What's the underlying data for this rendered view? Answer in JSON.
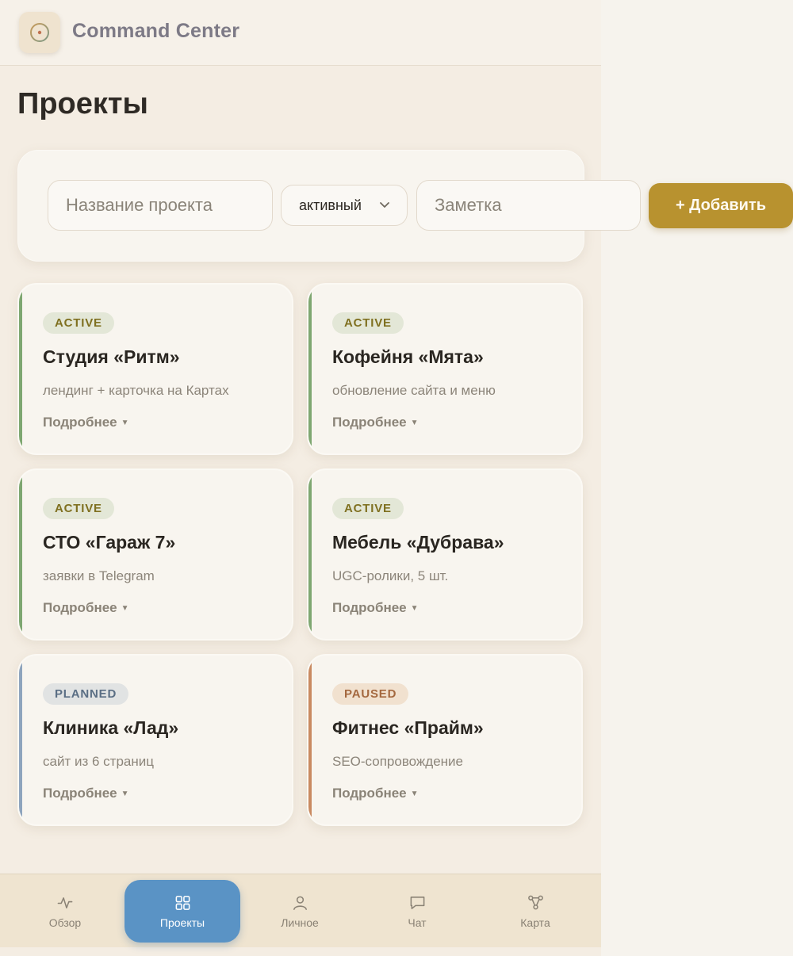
{
  "app": {
    "title": "Command Center",
    "logo_icon": "target-icon"
  },
  "page": {
    "title": "Проекты"
  },
  "form": {
    "name_placeholder": "Название проекта",
    "status_selected": "активный",
    "note_placeholder": "Заметка",
    "add_label": "+ Добавить"
  },
  "status_colors": {
    "active": {
      "stripe": "#7ea771",
      "badge_bg": "#e3e7d7",
      "badge_fg": "#7f7020"
    },
    "planned": {
      "stripe": "#8ea4bd",
      "badge_bg": "#e1e3e3",
      "badge_fg": "#5a6e84"
    },
    "paused": {
      "stripe": "#c98a61",
      "badge_bg": "#f1e1cf",
      "badge_fg": "#a4683f"
    }
  },
  "projects": [
    {
      "status": "active",
      "badge": "ACTIVE",
      "title": "Студия «Ритм»",
      "note": "лендинг + карточка на Картах",
      "more": "Подробнее"
    },
    {
      "status": "active",
      "badge": "ACTIVE",
      "title": "Кофейня «Мята»",
      "note": "обновление сайта и меню",
      "more": "Подробнее"
    },
    {
      "status": "active",
      "badge": "ACTIVE",
      "title": "СТО «Гараж 7»",
      "note": "заявки в Telegram",
      "more": "Подробнее"
    },
    {
      "status": "active",
      "badge": "ACTIVE",
      "title": "Мебель «Дубрава»",
      "note": "UGC-ролики, 5 шт.",
      "more": "Подробнее"
    },
    {
      "status": "planned",
      "badge": "PLANNED",
      "title": "Клиника «Лад»",
      "note": "сайт из 6 страниц",
      "more": "Подробнее"
    },
    {
      "status": "paused",
      "badge": "PAUSED",
      "title": "Фитнес «Прайм»",
      "note": "SEO-сопровождение",
      "more": "Подробнее"
    }
  ],
  "nav": [
    {
      "label": "Обзор",
      "icon": "pulse-icon",
      "active": false
    },
    {
      "label": "Проекты",
      "icon": "grid-icon",
      "active": true
    },
    {
      "label": "Личное",
      "icon": "user-icon",
      "active": false
    },
    {
      "label": "Чат",
      "icon": "chat-icon",
      "active": false
    },
    {
      "label": "Карта",
      "icon": "graph-icon",
      "active": false
    }
  ]
}
